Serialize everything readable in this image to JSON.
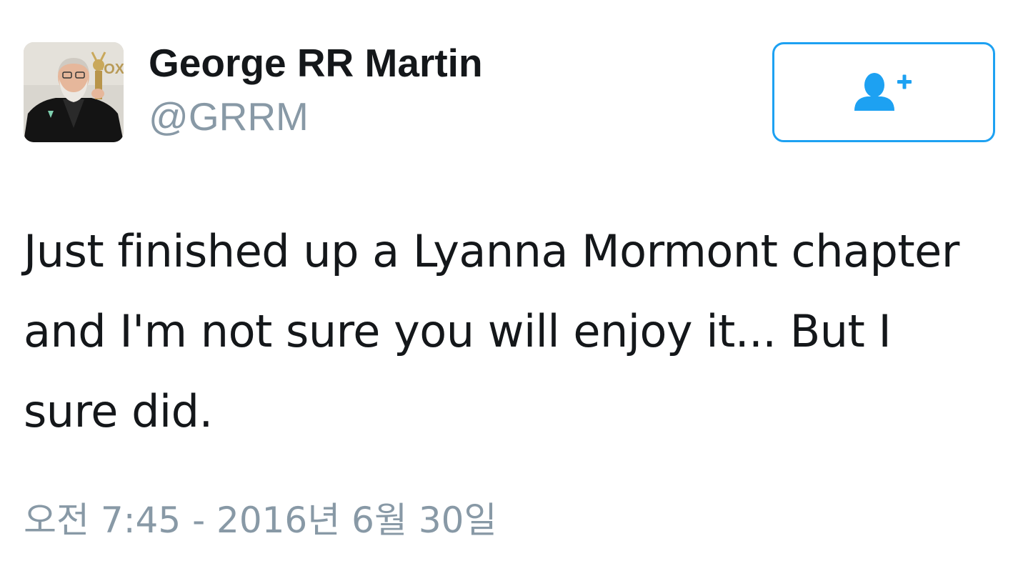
{
  "tweet": {
    "author": {
      "display_name": "George RR Martin",
      "handle": "@GRRM",
      "avatar_logo_text": "FOX"
    },
    "follow_button": {
      "icon": "add-user-icon"
    },
    "text": "Just finished up a Lyanna Mormont chapter and I'm not sure you will enjoy it... But I sure did.",
    "timestamp": "오전 7:45 - 2016년 6월 30일"
  },
  "colors": {
    "accent": "#1da1f2",
    "text_primary": "#14171a",
    "text_secondary": "#8899a6",
    "background": "#ffffff"
  }
}
